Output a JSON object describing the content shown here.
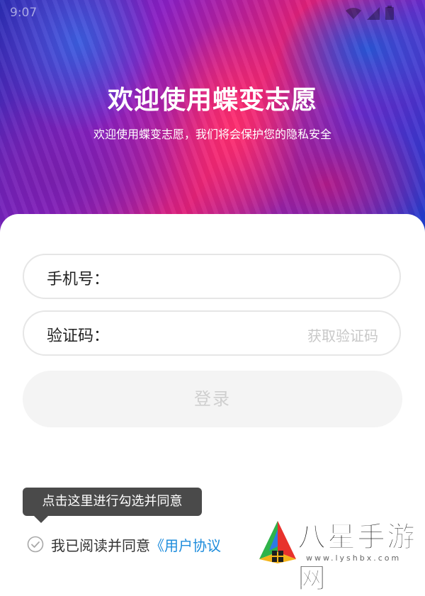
{
  "status_bar": {
    "time": "9:07",
    "icons": [
      "wifi-icon",
      "signal-icon",
      "battery-icon"
    ]
  },
  "hero": {
    "title": "欢迎使用蝶变志愿",
    "subtitle": "欢迎使用蝶变志愿，我们将会保护您的隐私安全"
  },
  "form": {
    "phone_label": "手机号：",
    "code_label": "验证码：",
    "get_code_label": "获取验证码",
    "login_label": "登录"
  },
  "tooltip": {
    "text": "点击这里进行勾选并同意"
  },
  "agreement": {
    "prefix": "我已阅读并同意",
    "link": "《用户协议"
  },
  "watermark": {
    "brand": "八星手游网",
    "url": "www.lyshbx.com"
  },
  "colors": {
    "link": "#1d8cdc",
    "tooltip_bg": "#4a4a4a",
    "button_bg": "#f4f4f4"
  }
}
